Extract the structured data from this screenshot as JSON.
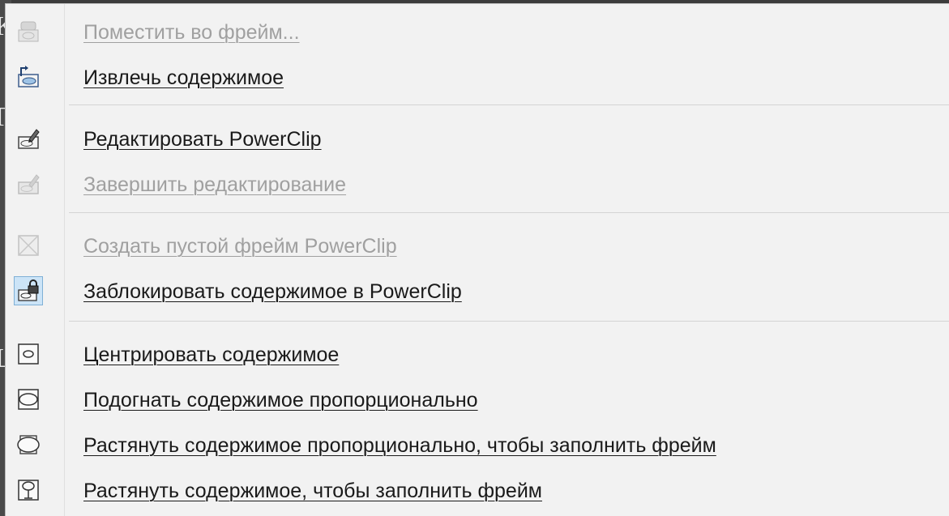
{
  "background": {
    "glyphs": [
      "К",
      "Г",
      "Ц"
    ]
  },
  "menu": {
    "items": [
      {
        "label": "Поместить во фрейм...",
        "icon": "place-inside-frame-icon",
        "disabled": true,
        "checked": false
      },
      {
        "label": "Извлечь содержимое",
        "icon": "extract-contents-icon",
        "disabled": false,
        "checked": false
      },
      {
        "label": "Редактировать PowerClip",
        "icon": "edit-powerclip-icon",
        "disabled": false,
        "checked": false
      },
      {
        "label": "Завершить редактирование",
        "icon": "finish-editing-icon",
        "disabled": true,
        "checked": false
      },
      {
        "label": "Создать пустой фрейм PowerClip",
        "icon": "empty-powerclip-frame-icon",
        "disabled": true,
        "checked": false
      },
      {
        "label": "Заблокировать содержимое в PowerClip",
        "icon": "lock-contents-icon",
        "disabled": false,
        "checked": true
      },
      {
        "label": "Центрировать содержимое",
        "icon": "center-contents-icon",
        "disabled": false,
        "checked": false
      },
      {
        "label": "Подогнать содержимое пропорционально",
        "icon": "fit-proportionally-icon",
        "disabled": false,
        "checked": false
      },
      {
        "label": "Растянуть содержимое пропорционально, чтобы заполнить фрейм",
        "icon": "fill-proportionally-icon",
        "disabled": false,
        "checked": false
      },
      {
        "label": "Растянуть содержимое, чтобы заполнить фрейм",
        "icon": "stretch-to-fill-icon",
        "disabled": false,
        "checked": false
      }
    ]
  },
  "colors": {
    "menu_bg": "#f2f2f2",
    "text": "#1a1a1a",
    "disabled_text": "#a0a0a0",
    "checked_bg": "#cce4f7",
    "checked_border": "#7fb0d6",
    "separator": "#d4d4d4"
  }
}
